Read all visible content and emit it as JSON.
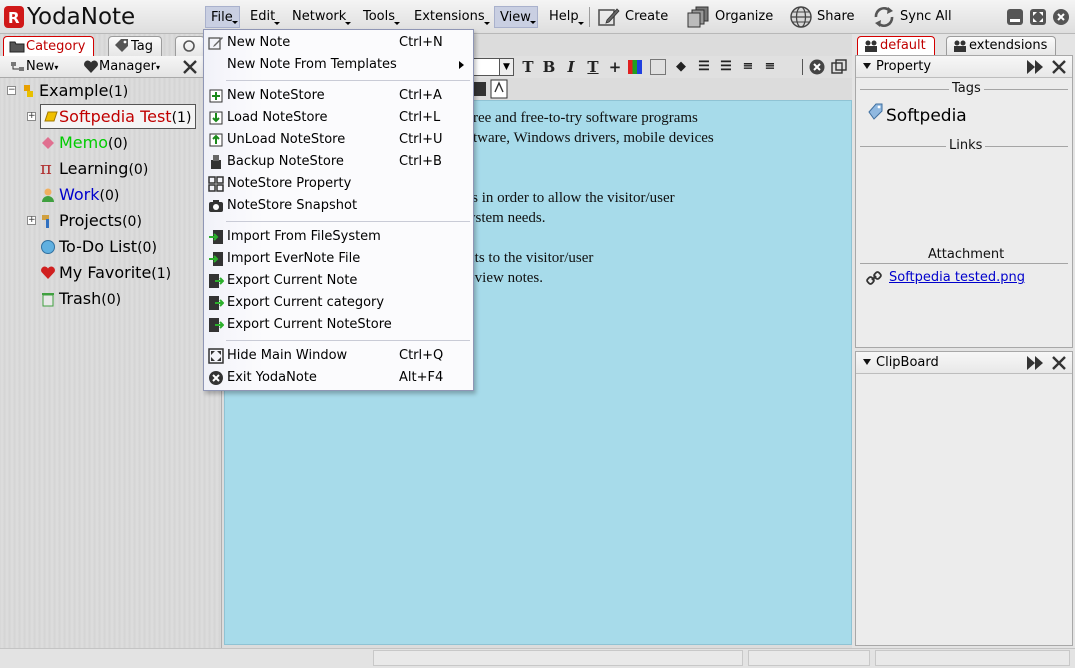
{
  "app": {
    "title": "YodaNote"
  },
  "menubar": {
    "items": [
      {
        "label": "File"
      },
      {
        "label": "Edit"
      },
      {
        "label": "Network"
      },
      {
        "label": "Tools"
      },
      {
        "label": "Extensions"
      },
      {
        "label": "View"
      },
      {
        "label": "Help"
      }
    ],
    "tools": {
      "create": "Create",
      "organize": "Organize",
      "share": "Share",
      "sync": "Sync All"
    }
  },
  "left": {
    "tabs": {
      "category": "Category",
      "tag": "Tag"
    },
    "toolbar": {
      "new": "New",
      "manager": "Manager"
    },
    "tree": [
      {
        "label": "Example",
        "count": "(1)"
      },
      {
        "label": "Softpedia Test",
        "count": "(1)",
        "color": "#c00000"
      },
      {
        "label": "Memo",
        "count": "(0)",
        "color": "#00cc00"
      },
      {
        "label": "Learning",
        "count": "(0)"
      },
      {
        "label": "Work",
        "count": "(0)",
        "color": "#0000cc"
      },
      {
        "label": "Projects",
        "count": "(0)"
      },
      {
        "label": "To-Do List",
        "count": "(0)"
      },
      {
        "label": "My Favorite",
        "count": "(1)"
      },
      {
        "label": "Trash",
        "count": "(0)"
      }
    ]
  },
  "editor": {
    "lines": [
      "free and free-to-try software programs",
      "ftware, Windows drivers, mobile devices",
      "ts in order to allow the visitor/user",
      "ystem needs.",
      "cts to the visitor/user",
      "eview notes."
    ]
  },
  "right": {
    "tabs": {
      "default": "default",
      "extensions": "extendsions"
    },
    "property": {
      "title": "Property",
      "tags_label": "Tags",
      "tag": "Softpedia",
      "links_label": "Links",
      "attachment_label": "Attachment",
      "attachment_file": "Softpedia tested.png"
    },
    "clipboard": {
      "title": "ClipBoard"
    }
  },
  "file_menu": {
    "items": [
      {
        "label": "New Note",
        "key": "Ctrl+N",
        "icon": "pencil-icon"
      },
      {
        "label": "New Note From Templates",
        "key": "",
        "icon": "",
        "submenu": true
      },
      {
        "label": "New NoteStore",
        "key": "Ctrl+A",
        "icon": "new-store-icon"
      },
      {
        "label": "Load NoteStore",
        "key": "Ctrl+L",
        "icon": "load-store-icon"
      },
      {
        "label": "UnLoad NoteStore",
        "key": "Ctrl+U",
        "icon": "unload-store-icon"
      },
      {
        "label": "Backup NoteStore",
        "key": "Ctrl+B",
        "icon": "backup-icon"
      },
      {
        "label": "NoteStore Property",
        "key": "",
        "icon": "property-grid-icon"
      },
      {
        "label": "NoteStore Snapshot",
        "key": "",
        "icon": "camera-icon"
      },
      {
        "label": "Import From FileSystem",
        "key": "",
        "icon": "import-icon"
      },
      {
        "label": "Import EverNote File",
        "key": "",
        "icon": "import-icon"
      },
      {
        "label": "Export Current Note",
        "key": "",
        "icon": "export-icon"
      },
      {
        "label": "Export Current category",
        "key": "",
        "icon": "export-icon"
      },
      {
        "label": "Export Current NoteStore",
        "key": "",
        "icon": "export-icon"
      },
      {
        "label": "Hide Main Window",
        "key": "Ctrl+Q",
        "icon": "hide-window-icon"
      },
      {
        "label": "Exit YodaNote",
        "key": "Alt+F4",
        "icon": "exit-icon"
      }
    ]
  }
}
